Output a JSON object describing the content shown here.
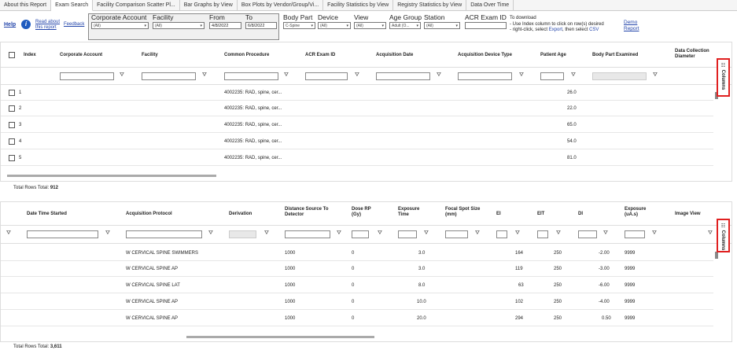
{
  "tabs": [
    "About this Report",
    "Exam Search",
    "Facility Comparison Scatter Pl...",
    "Bar Graphs by View",
    "Box Plots by Vendor/Group/Vi...",
    "Facility Statistics by View",
    "Registry Statistics by View",
    "Data Over Time"
  ],
  "filters": {
    "help": "Help",
    "read_about": "Read about this report",
    "feedback": "Feedback",
    "corporate_account_label": "Corporate Account",
    "corporate_account_value": "(All)",
    "facility_label": "Facility",
    "facility_value": "(All)",
    "from_label": "From",
    "from_value": "4/8/2022",
    "to_label": "To",
    "to_value": "6/8/2022",
    "body_part_label": "Body Part",
    "body_part_value": "C-Spine",
    "device_label": "Device",
    "device_value": "(All)",
    "view_label": "View",
    "view_value": "(All)",
    "age_group_label": "Age Group",
    "age_group_value": "Adult (O...",
    "station_label": "Station",
    "station_value": "(All)",
    "acr_exam_id_label": "ACR Exam ID",
    "download_title": "To download",
    "download_line1": "- Use Index column to click on row(s) desired",
    "download_line2_pre": "- right-click, select ",
    "download_export": "Export",
    "download_then": ", then select ",
    "download_csv": "CSV",
    "demo_report": "Demo Report"
  },
  "grid1": {
    "headers": [
      "Index",
      "Corporate Account",
      "Facility",
      "Common Procedure",
      "ACR Exam ID",
      "Acquisition Date",
      "Acquisition Device Type",
      "Patient Age",
      "Body Part Examined",
      "Data Collection Diameter"
    ],
    "rows": [
      {
        "index": "1",
        "procedure": "4002235: RAD, spine, cer...",
        "age": "26.0"
      },
      {
        "index": "2",
        "procedure": "4002235: RAD, spine, cer...",
        "age": "22.0"
      },
      {
        "index": "3",
        "procedure": "4002235: RAD, spine, cer...",
        "age": "65.0"
      },
      {
        "index": "4",
        "procedure": "4002235: RAD, spine, cer...",
        "age": "54.0"
      },
      {
        "index": "5",
        "procedure": "4002235: RAD, spine, cer...",
        "age": "81.0"
      }
    ],
    "total_label": "Total Rows Total: ",
    "total_value": "912",
    "columns_btn": "Columns"
  },
  "grid2": {
    "headers": [
      "Date Time Started",
      "Acquisition Protocol",
      "Derivation",
      "Distance Source To Detector",
      "Dose RP (Gy)",
      "Exposure Time",
      "Focal Spot Size (mm)",
      "EI",
      "EIT",
      "DI",
      "Exposure (uA.s)",
      "Image View"
    ],
    "rows": [
      {
        "protocol": "W CERVICAL SPINE SWIMMERS",
        "dist": "1000",
        "dose": "0",
        "exptime": "3.0",
        "ei": "164",
        "eit": "250",
        "di": "-2.00",
        "exposure": "9999"
      },
      {
        "protocol": "W CERVICAL SPINE AP",
        "dist": "1000",
        "dose": "0",
        "exptime": "3.0",
        "ei": "119",
        "eit": "250",
        "di": "-3.00",
        "exposure": "9999"
      },
      {
        "protocol": "W CERVICAL SPINE LAT",
        "dist": "1000",
        "dose": "0",
        "exptime": "8.0",
        "ei": "63",
        "eit": "250",
        "di": "-6.00",
        "exposure": "9999"
      },
      {
        "protocol": "W CERVICAL SPINE AP",
        "dist": "1000",
        "dose": "0",
        "exptime": "10.0",
        "ei": "102",
        "eit": "250",
        "di": "-4.00",
        "exposure": "9999"
      },
      {
        "protocol": "W CERVICAL SPINE AP",
        "dist": "1000",
        "dose": "0",
        "exptime": "20.0",
        "ei": "294",
        "eit": "250",
        "di": "0.50",
        "exposure": "9999"
      }
    ],
    "total_label": "Total Rows Total: ",
    "total_value": "3,611",
    "columns_btn": "Columns"
  },
  "colors": {
    "accent": "#1e5bbf",
    "highlight_border": "#e02020"
  }
}
